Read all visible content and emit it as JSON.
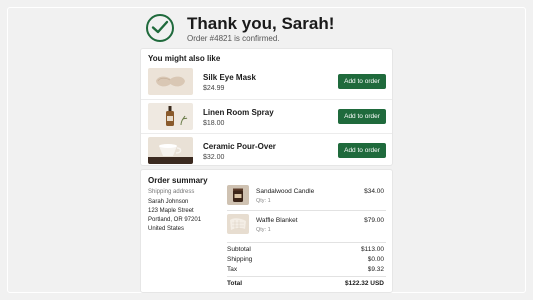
{
  "header": {
    "title": "Thank you, Sarah!",
    "subtitle": "Order #4821 is confirmed."
  },
  "upsell": {
    "title": "You might also like",
    "button_label": "Add to order",
    "products": [
      {
        "name": "Silk Eye Mask",
        "price": "$24.99"
      },
      {
        "name": "Linen Room Spray",
        "price": "$18.00"
      },
      {
        "name": "Ceramic Pour-Over",
        "price": "$32.00"
      }
    ]
  },
  "summary": {
    "title": "Order summary",
    "shipping_label": "Shipping address",
    "address": [
      "Sarah Johnson",
      "123 Maple Street",
      "Portland, OR 97201",
      "United States"
    ],
    "items": [
      {
        "name": "Sandalwood Candle",
        "qty": "Qty: 1",
        "price": "$34.00"
      },
      {
        "name": "Waffle Blanket",
        "qty": "Qty: 1",
        "price": "$79.00"
      }
    ],
    "totals": [
      {
        "label": "Subtotal",
        "value": "$113.00"
      },
      {
        "label": "Shipping",
        "value": "$0.00"
      },
      {
        "label": "Tax",
        "value": "$9.32"
      }
    ],
    "grand_total": {
      "label": "Total",
      "value": "$122.32 USD"
    }
  },
  "colors": {
    "accent": "#1f6a3c",
    "background": "#f1f1f1",
    "card": "#ffffff"
  }
}
